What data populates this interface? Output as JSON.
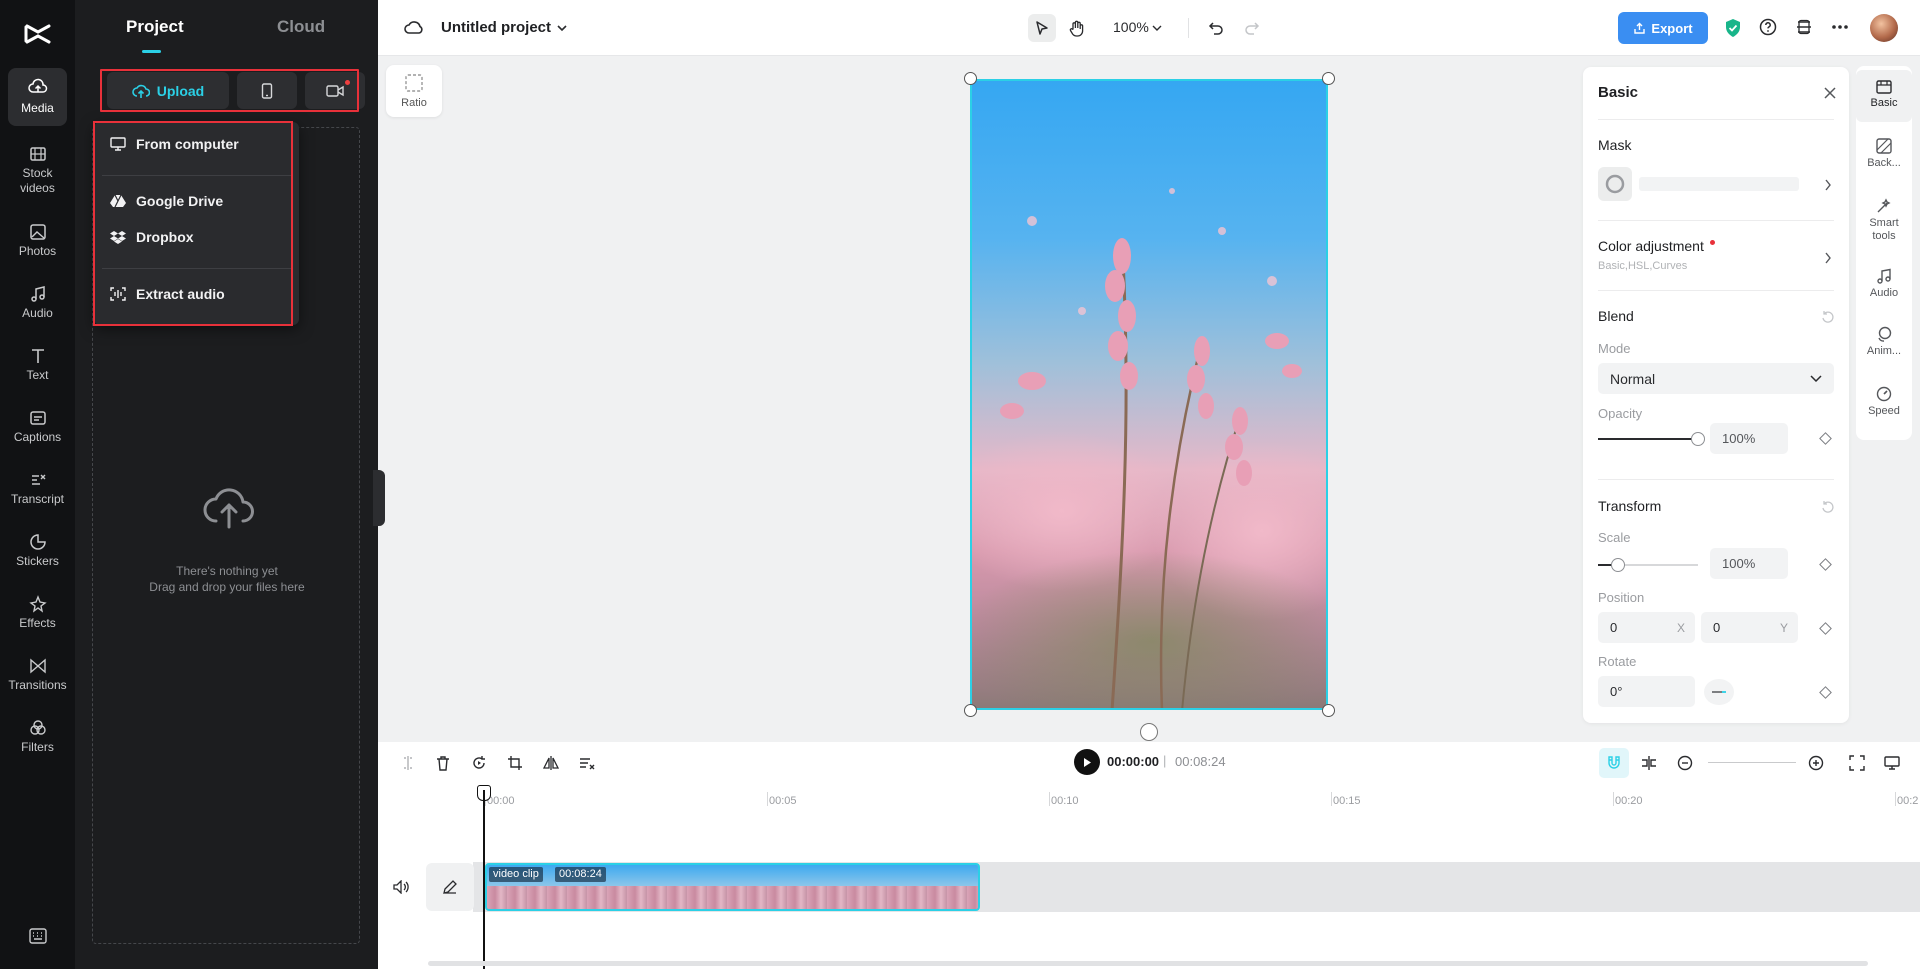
{
  "rail": {
    "items": [
      {
        "label": "Media",
        "icon": "media-icon"
      },
      {
        "label": "Stock videos",
        "icon": "stock-videos-icon"
      },
      {
        "label": "Photos",
        "icon": "photos-icon"
      },
      {
        "label": "Audio",
        "icon": "audio-icon"
      },
      {
        "label": "Text",
        "icon": "text-icon"
      },
      {
        "label": "Captions",
        "icon": "captions-icon"
      },
      {
        "label": "Transcript",
        "icon": "transcript-icon"
      },
      {
        "label": "Stickers",
        "icon": "stickers-icon"
      },
      {
        "label": "Effects",
        "icon": "effects-icon"
      },
      {
        "label": "Transitions",
        "icon": "transitions-icon"
      },
      {
        "label": "Filters",
        "icon": "filters-icon"
      }
    ],
    "active": "Media"
  },
  "panel": {
    "tabs": [
      "Project",
      "Cloud"
    ],
    "active_tab": "Project",
    "upload_label": "Upload",
    "empty_line1": "There's nothing yet",
    "empty_line2": "Drag and drop your files here",
    "menu": [
      "From computer",
      "Google Drive",
      "Dropbox",
      "Extract audio"
    ]
  },
  "topbar": {
    "project_title": "Untitled project",
    "zoom": "100%",
    "export_label": "Export"
  },
  "canvas": {
    "ratio_label": "Ratio"
  },
  "basic_panel": {
    "title": "Basic",
    "mask_label": "Mask",
    "color_adjustment_label": "Color adjustment",
    "color_adjustment_sub": "Basic,HSL,Curves",
    "blend_label": "Blend",
    "mode_label": "Mode",
    "mode_value": "Normal",
    "opacity_label": "Opacity",
    "opacity_value": "100%",
    "opacity_level": 1.0,
    "transform_label": "Transform",
    "scale_label": "Scale",
    "scale_value": "100%",
    "scale_level": 0.2,
    "position_label": "Position",
    "position_x": "0",
    "position_y": "0",
    "axis_x": "X",
    "axis_y": "Y",
    "rotate_label": "Rotate",
    "rotate_value": "0°"
  },
  "right_rail": {
    "items": [
      "Basic",
      "Back...",
      "Smart tools",
      "Audio",
      "Anim...",
      "Speed"
    ],
    "active": "Basic"
  },
  "timeline": {
    "current_time": "00:00:00",
    "separator": "|",
    "total_time": "00:08:24",
    "ticks": [
      "00:00",
      "00:05",
      "00:10",
      "00:15",
      "00:20",
      "00:2"
    ],
    "clip_name": "video clip",
    "clip_duration": "00:08:24"
  },
  "colors": {
    "accent": "#2bd0e6",
    "export": "#3a8ef2",
    "highlight": "#e8313a",
    "dark_bg": "#111214"
  }
}
